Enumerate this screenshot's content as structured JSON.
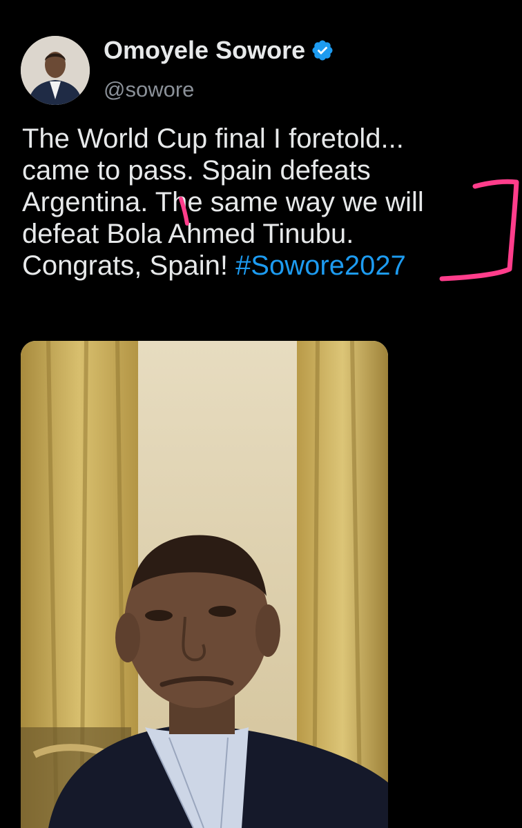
{
  "tweet": {
    "author": {
      "display_name": "Omoyele Sowore",
      "handle": "@sowore",
      "verified": true,
      "avatar": "profile-photo"
    },
    "text_lines": [
      "The World Cup final I foretold...",
      "came to pass. Spain defeats",
      "Argentina. The same way we will",
      "defeat Bola Ahmed Tinubu.",
      "Congrats, Spain! "
    ],
    "hashtag": "#Sowore2027",
    "media": {
      "type": "video-still",
      "subject": "man seated in front of yellow curtains"
    }
  },
  "colors": {
    "background": "#000000",
    "text": "#e7e9ea",
    "secondary_text": "#8b9199",
    "link": "#1d9bf0",
    "annotation_marker": "#ff3d8b"
  }
}
